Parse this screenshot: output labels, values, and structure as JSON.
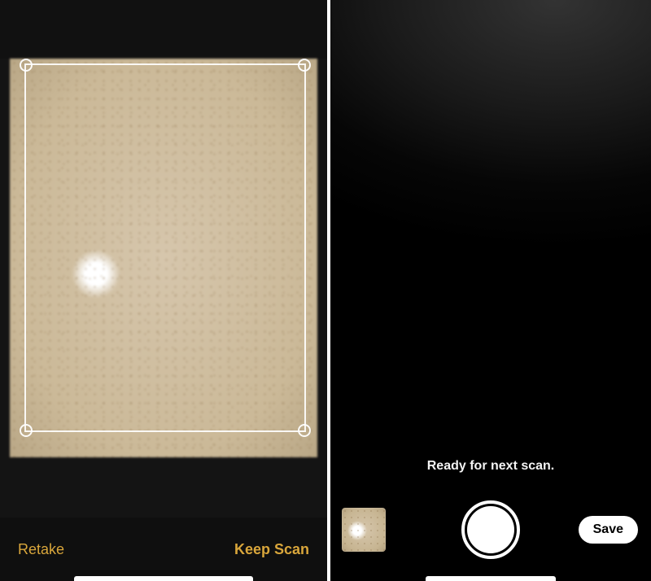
{
  "leftPane": {
    "retakeLabel": "Retake",
    "keepScanLabel": "Keep Scan"
  },
  "rightPane": {
    "statusText": "Ready for next scan.",
    "saveLabel": "Save"
  },
  "colors": {
    "accentGold": "#d9a63b",
    "background": "#000000",
    "darkPanel": "#111111"
  }
}
